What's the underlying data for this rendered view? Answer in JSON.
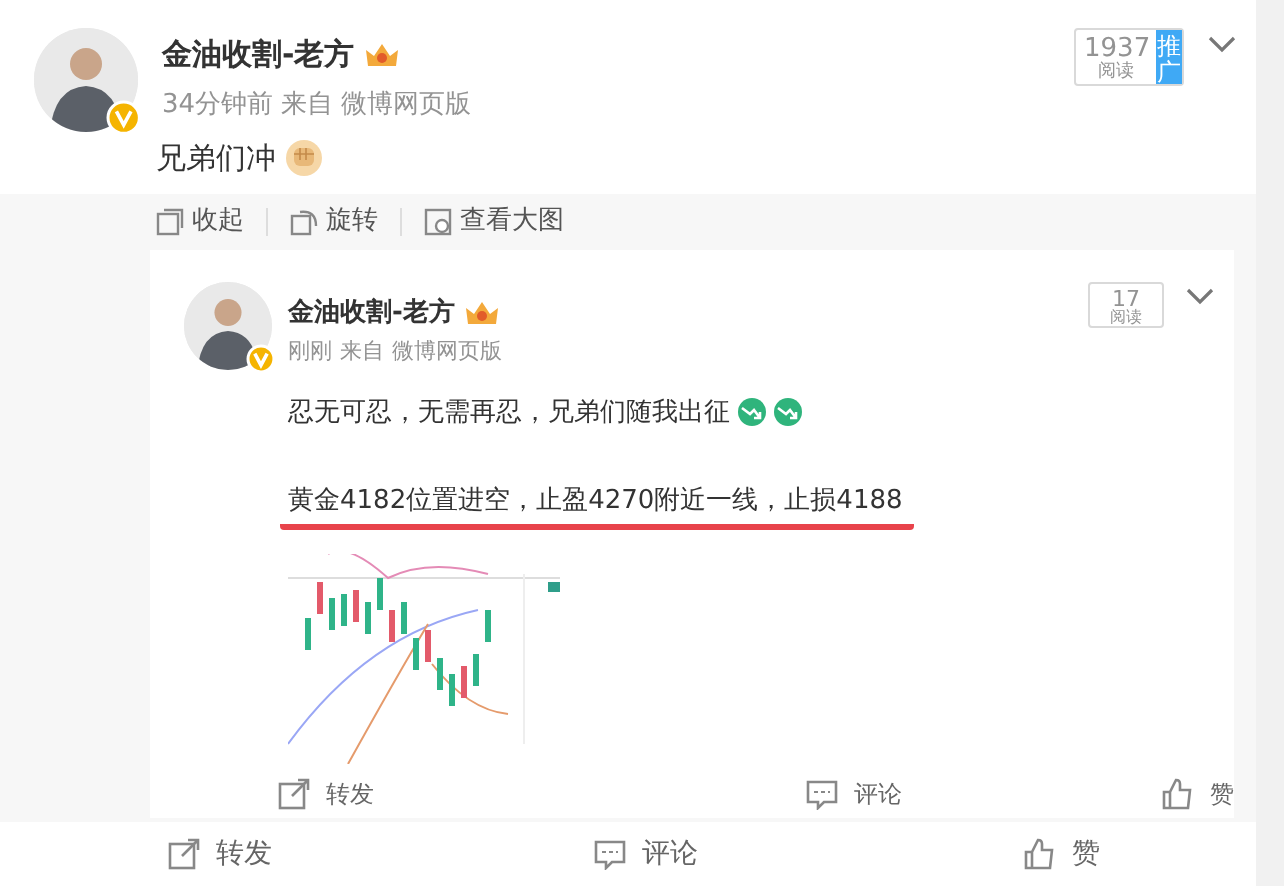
{
  "post": {
    "author": "金油收割-老方",
    "time": "34分钟前",
    "source_prefix": "来自",
    "source": "微博网页版",
    "reads": "1937",
    "reads_label": "阅读",
    "promo": "推广",
    "text": "兄弟们冲"
  },
  "image_toolbar": [
    {
      "kind": "collapse",
      "label": "收起"
    },
    {
      "kind": "rotate",
      "label": "旋转"
    },
    {
      "kind": "view",
      "label": "查看大图"
    }
  ],
  "shared_image": {
    "author": "金油收割-老方",
    "time": "刚刚",
    "source_prefix": "来自",
    "source": "微博网页版",
    "reads": "17",
    "reads_label": "阅读",
    "line1": "忍无可忍，无需再忍，兄弟们随我出征",
    "line2": "黄金4182位置进空，止盈4270附近一线，止损4188",
    "actions": [
      {
        "kind": "share",
        "label": "转发"
      },
      {
        "kind": "comment",
        "label": "评论"
      },
      {
        "kind": "like",
        "label": "赞"
      }
    ]
  },
  "actions": [
    {
      "kind": "share",
      "label": "转发"
    },
    {
      "kind": "comment",
      "label": "评论"
    },
    {
      "kind": "like",
      "label": "赞"
    }
  ]
}
